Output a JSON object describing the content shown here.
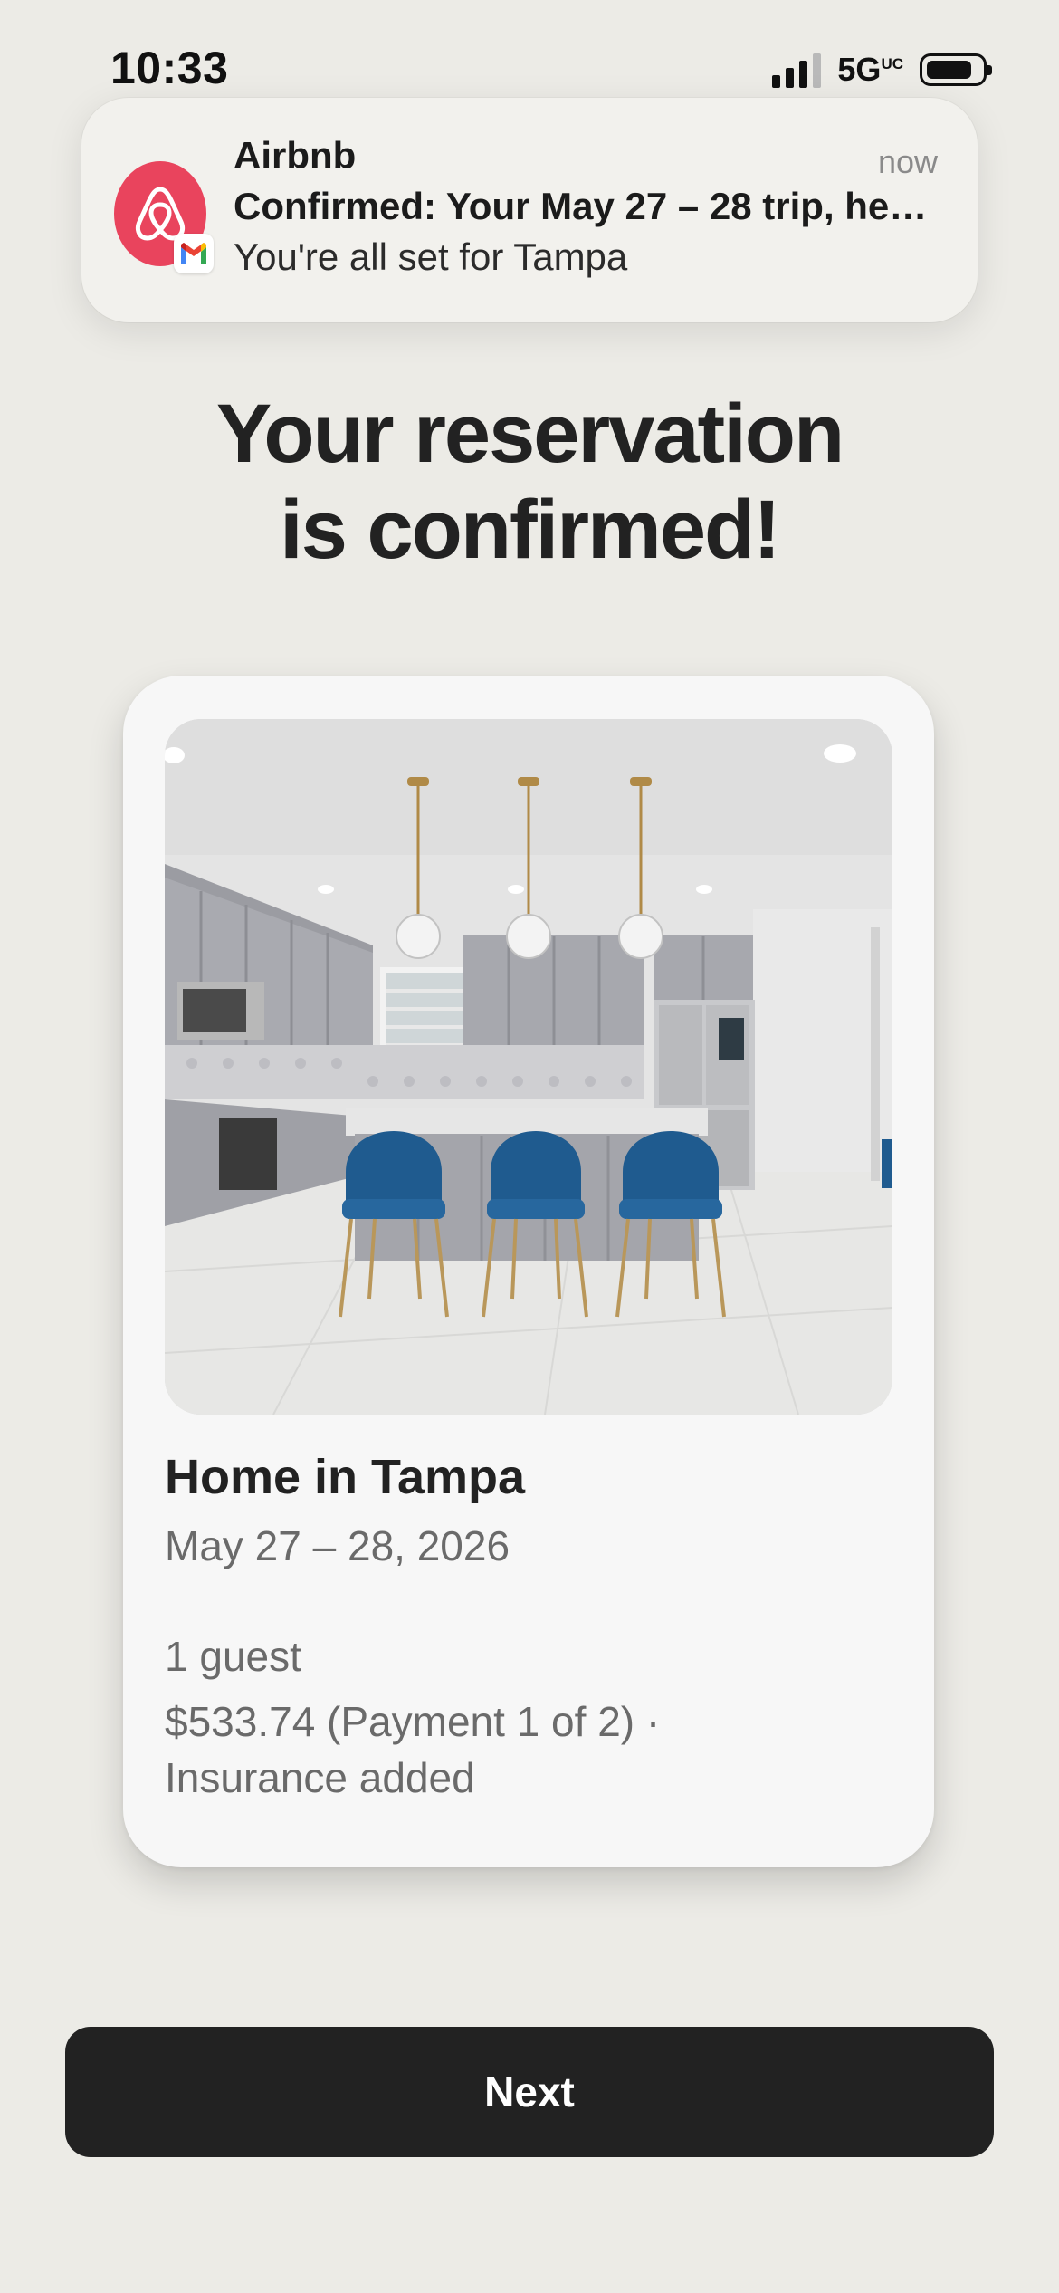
{
  "status_bar": {
    "time": "10:33",
    "network": "5G",
    "network_suffix": "UC",
    "battery_level": 0.72,
    "icons": [
      "cellular-signal-icon",
      "battery-icon"
    ]
  },
  "notification": {
    "app_name": "Airbnb",
    "time": "now",
    "title": "Confirmed: Your May 27 – 28 trip, here’…",
    "body": "You're all set for Tampa",
    "icons": [
      "airbnb-logo-icon",
      "gmail-badge-icon"
    ],
    "colors": {
      "airbnb": "#e9445d"
    }
  },
  "headline": {
    "line1": "Your reservation",
    "line2": "is confirmed!"
  },
  "listing": {
    "photo_icon": "kitchen-photo",
    "title": "Home in Tampa",
    "dates": "May 27 – 28, 2026",
    "guests": "1 guest",
    "payment": "$533.74 (Payment 1 of 2) · Insurance added"
  },
  "actions": {
    "next_label": "Next"
  },
  "colors": {
    "background": "#ecebe6",
    "button": "#222222",
    "card": "#f7f7f7"
  }
}
